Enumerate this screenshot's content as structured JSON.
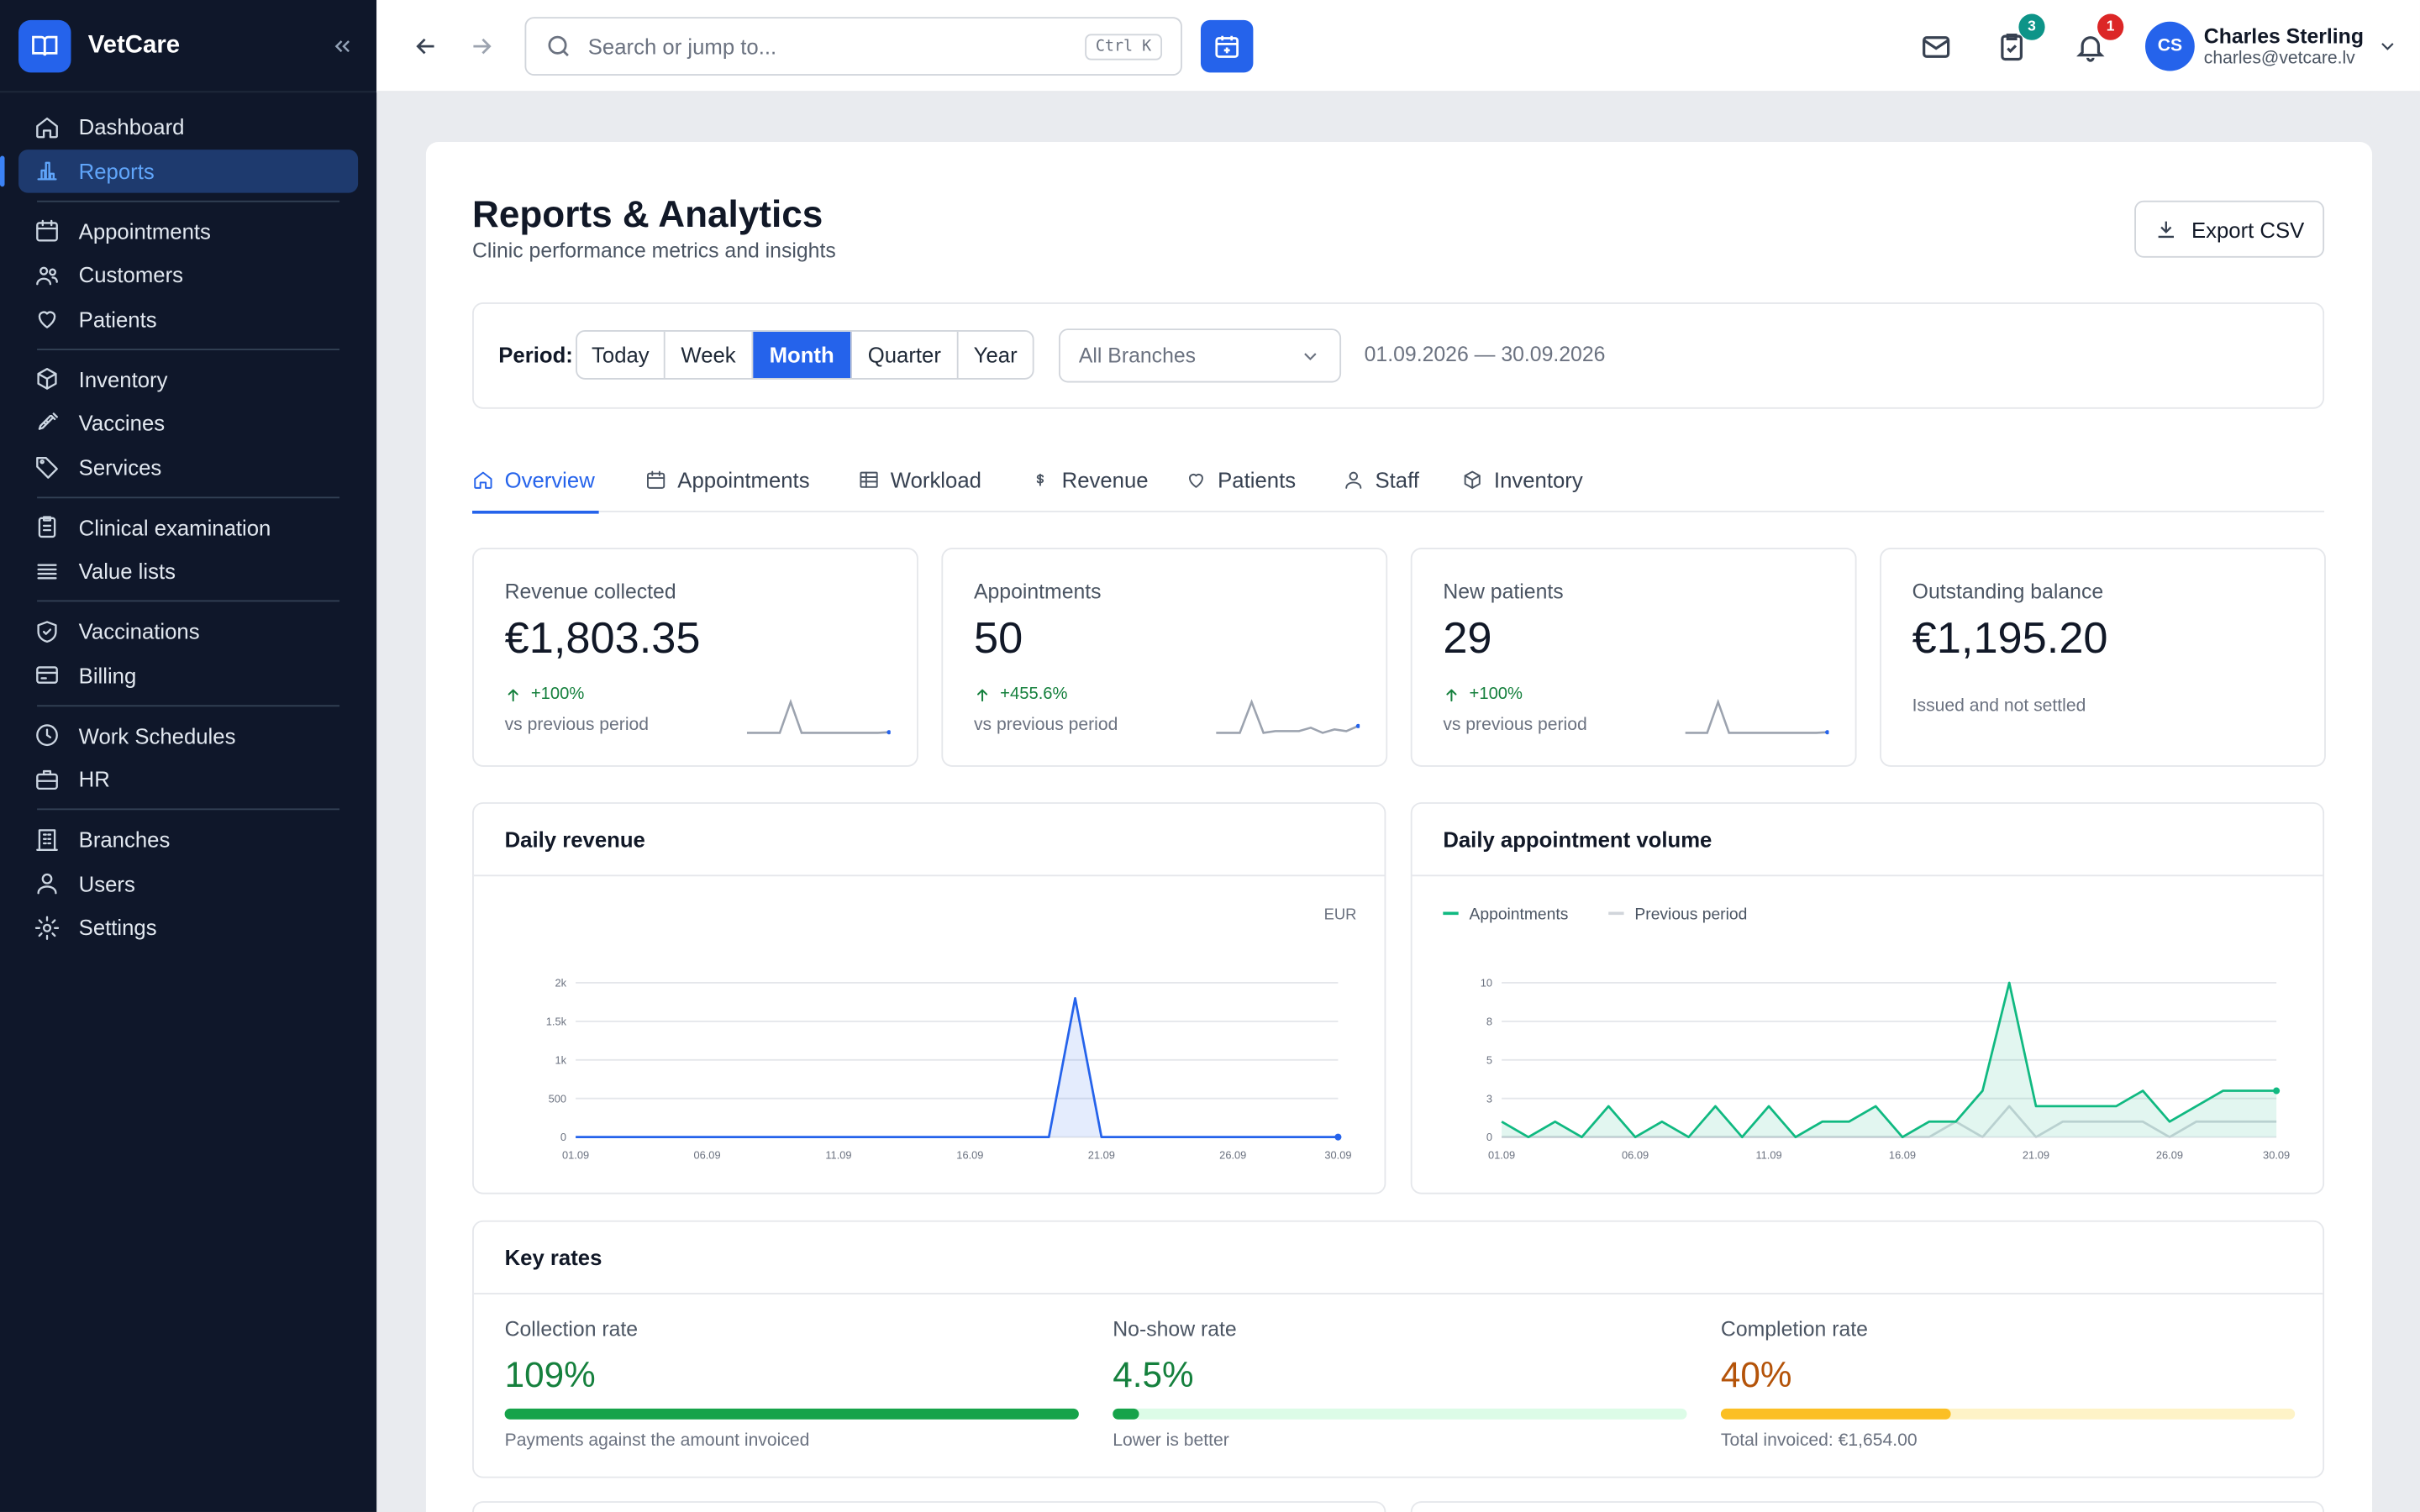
{
  "app": {
    "name": "VetCare"
  },
  "sidebar": {
    "items": [
      {
        "label": "Dashboard",
        "icon": "home-icon"
      },
      {
        "label": "Reports",
        "icon": "bar-chart-icon",
        "active": true
      },
      {
        "label": "Appointments",
        "icon": "calendar-icon"
      },
      {
        "label": "Customers",
        "icon": "users-icon"
      },
      {
        "label": "Patients",
        "icon": "heart-icon"
      },
      {
        "label": "Inventory",
        "icon": "box-icon"
      },
      {
        "label": "Vaccines",
        "icon": "syringe-icon"
      },
      {
        "label": "Services",
        "icon": "tag-icon"
      },
      {
        "label": "Clinical examination",
        "icon": "clipboard-icon"
      },
      {
        "label": "Value lists",
        "icon": "list-icon"
      },
      {
        "label": "Vaccinations",
        "icon": "shield-check-icon"
      },
      {
        "label": "Billing",
        "icon": "credit-card-icon"
      },
      {
        "label": "Work Schedules",
        "icon": "clock-icon"
      },
      {
        "label": "HR",
        "icon": "briefcase-icon"
      },
      {
        "label": "Branches",
        "icon": "building-icon"
      },
      {
        "label": "Users",
        "icon": "user-icon"
      },
      {
        "label": "Settings",
        "icon": "gear-icon"
      }
    ]
  },
  "topbar": {
    "search_placeholder": "Search or jump to...",
    "search_shortcut": "Ctrl K",
    "tasks_count": "3",
    "notifications_count": "1",
    "user": {
      "initials": "CS",
      "name": "Charles Sterling",
      "email": "charles@vetcare.lv"
    }
  },
  "page": {
    "title": "Reports & Analytics",
    "subtitle": "Clinic performance metrics and insights",
    "export_label": "Export CSV"
  },
  "filters": {
    "period_label": "Period:",
    "periods": [
      "Today",
      "Week",
      "Month",
      "Quarter",
      "Year"
    ],
    "selected_period": "Month",
    "branch_value": "All Branches",
    "date_range": "01.09.2026 — 30.09.2026"
  },
  "tabs": [
    "Overview",
    "Appointments",
    "Workload",
    "Revenue",
    "Patients",
    "Staff",
    "Inventory"
  ],
  "stats": [
    {
      "label": "Revenue collected",
      "value": "€1,803.35",
      "delta": "+100%",
      "note": "vs previous period",
      "spark": [
        0,
        0,
        0,
        0,
        10,
        0,
        0,
        0,
        0,
        0,
        0,
        0,
        0,
        0.2
      ]
    },
    {
      "label": "Appointments",
      "value": "50",
      "delta": "+455.6%",
      "note": "vs previous period",
      "spark": [
        0,
        0,
        0,
        9,
        0,
        0.5,
        0.5,
        0.5,
        1.5,
        0,
        1,
        0.5,
        2
      ]
    },
    {
      "label": "New patients",
      "value": "29",
      "delta": "+100%",
      "note": "vs previous period",
      "spark": [
        0,
        0,
        0,
        10,
        0,
        0,
        0,
        0,
        0,
        0,
        0,
        0,
        0,
        0.2
      ]
    },
    {
      "label": "Outstanding balance",
      "value": "€1,195.20",
      "note": "Issued and not settled"
    }
  ],
  "revenue_panel": {
    "title": "Daily revenue",
    "unit": "EUR"
  },
  "volume_panel": {
    "title": "Daily appointment volume"
  },
  "rates": {
    "title": "Key rates",
    "items": [
      {
        "label": "Collection rate",
        "value": "109%",
        "note": "Payments against the amount invoiced",
        "fill": 1.0,
        "color": "#15803d",
        "bar": "#16a34a",
        "track": "#dcfce7"
      },
      {
        "label": "No-show rate",
        "value": "4.5%",
        "note": "Lower is better",
        "fill": 0.045,
        "color": "#15803d",
        "bar": "#16a34a",
        "track": "#dcfce7"
      },
      {
        "label": "Completion rate",
        "value": "40%",
        "note": "Total invoiced: €1,654.00",
        "fill": 0.4,
        "color": "#b45309",
        "bar": "#fbbf24",
        "track": "#fef3c7"
      }
    ]
  },
  "chart_data": [
    {
      "type": "area",
      "title": "Daily revenue",
      "unit": "EUR",
      "x": [
        "01.09",
        "02.09",
        "03.09",
        "04.09",
        "05.09",
        "06.09",
        "07.09",
        "08.09",
        "09.09",
        "10.09",
        "11.09",
        "12.09",
        "13.09",
        "14.09",
        "15.09",
        "16.09",
        "17.09",
        "18.09",
        "19.09",
        "20.09",
        "21.09",
        "22.09",
        "23.09",
        "24.09",
        "25.09",
        "26.09",
        "27.09",
        "28.09",
        "29.09",
        "30.09"
      ],
      "x_ticks": [
        "01.09",
        "06.09",
        "11.09",
        "16.09",
        "21.09",
        "26.09",
        "30.09"
      ],
      "y_ticks": [
        "0",
        "500",
        "1k",
        "1.5k",
        "2k"
      ],
      "ylim": [
        0,
        2000
      ],
      "series": [
        {
          "values": [
            0,
            0,
            0,
            0,
            0,
            0,
            0,
            0,
            0,
            0,
            0,
            0,
            0,
            0,
            0,
            0,
            0,
            0,
            0,
            1800,
            0,
            0,
            0,
            0,
            0,
            0,
            0,
            0,
            0,
            0
          ]
        }
      ]
    },
    {
      "type": "area",
      "title": "Daily appointment volume",
      "x": [
        "01.09",
        "02.09",
        "03.09",
        "04.09",
        "05.09",
        "06.09",
        "07.09",
        "08.09",
        "09.09",
        "10.09",
        "11.09",
        "12.09",
        "13.09",
        "14.09",
        "15.09",
        "16.09",
        "17.09",
        "18.09",
        "19.09",
        "20.09",
        "21.09",
        "22.09",
        "23.09",
        "24.09",
        "25.09",
        "26.09",
        "27.09",
        "28.09",
        "29.09",
        "30.09"
      ],
      "x_ticks": [
        "01.09",
        "06.09",
        "11.09",
        "16.09",
        "21.09",
        "26.09",
        "30.09"
      ],
      "y_ticks": [
        "0",
        "3",
        "5",
        "8",
        "10"
      ],
      "ylim": [
        0,
        10
      ],
      "legend": "top-left",
      "series": [
        {
          "name": "Appointments",
          "color": "#10b981",
          "values": [
            1,
            0,
            1,
            0,
            2,
            0,
            1,
            0,
            2,
            0,
            2,
            0,
            1,
            1,
            2,
            0,
            1,
            1,
            3,
            10,
            2,
            2,
            2,
            2,
            3,
            1,
            2,
            3,
            3,
            3
          ]
        },
        {
          "name": "Previous period",
          "color": "#d1d5db",
          "values": [
            0,
            0,
            0,
            0,
            0,
            0,
            0,
            0,
            0,
            0,
            0,
            0,
            0,
            0,
            0,
            0,
            0,
            1,
            0,
            2,
            0,
            1,
            1,
            1,
            1,
            0,
            1,
            1,
            1,
            1
          ]
        }
      ]
    }
  ]
}
